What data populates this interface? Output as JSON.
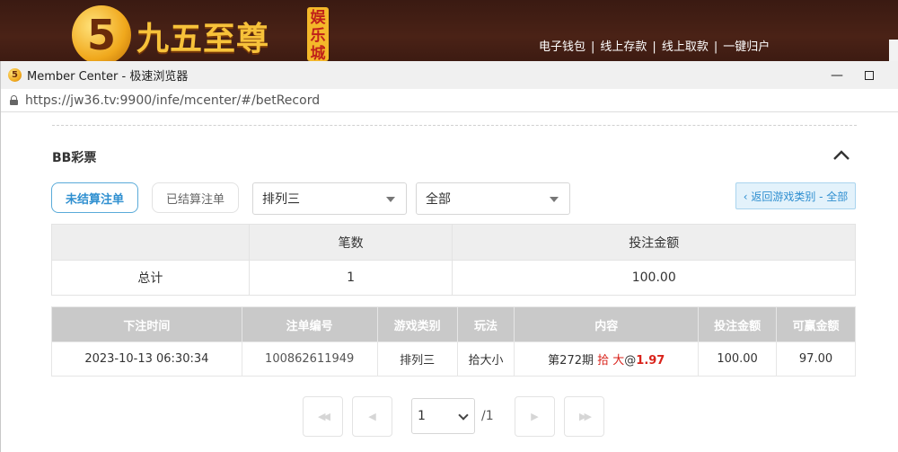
{
  "site": {
    "logo_glyph": "5",
    "logo_text": "九五至尊",
    "logo_tag": [
      "娱",
      "乐",
      "城"
    ],
    "nav": [
      "电子钱包",
      "线上存款",
      "线上取款",
      "一键归户"
    ]
  },
  "browser": {
    "title": "Member Center - 极速浏览器",
    "url": "https://jw36.tv:9900/infe/mcenter/#/betRecord"
  },
  "page": {
    "section_title": "BB彩票",
    "tabs": {
      "unsettled": "未结算注单",
      "settled": "已结算注单"
    },
    "game_select": "排列三",
    "type_select": "全部",
    "back_button": "‹ 返回游戏类别 - 全部"
  },
  "summary": {
    "headers": [
      "",
      "笔数",
      "投注金额"
    ],
    "row": [
      "总计",
      "1",
      "100.00"
    ]
  },
  "records": {
    "headers": [
      "下注时间",
      "注单编号",
      "游戏类别",
      "玩法",
      "内容",
      "投注金额",
      "可赢金额"
    ],
    "rows": [
      {
        "time": "2023-10-13 06:30:34",
        "order_no": "100862611949",
        "game": "排列三",
        "play": "拾大小",
        "content_prefix": "第272期",
        "content_pick": "拾 大",
        "content_at": "@",
        "content_odds": "1.97",
        "bet": "100.00",
        "win": "97.00"
      }
    ]
  },
  "pager": {
    "first": "◀◀",
    "prev": "◀",
    "current": "1",
    "total": "/1",
    "next": "▶",
    "last": "▶▶"
  },
  "colors": {
    "accent": "#2f8fd0",
    "red": "#d9231b",
    "header_bg": "#3a1a12"
  }
}
